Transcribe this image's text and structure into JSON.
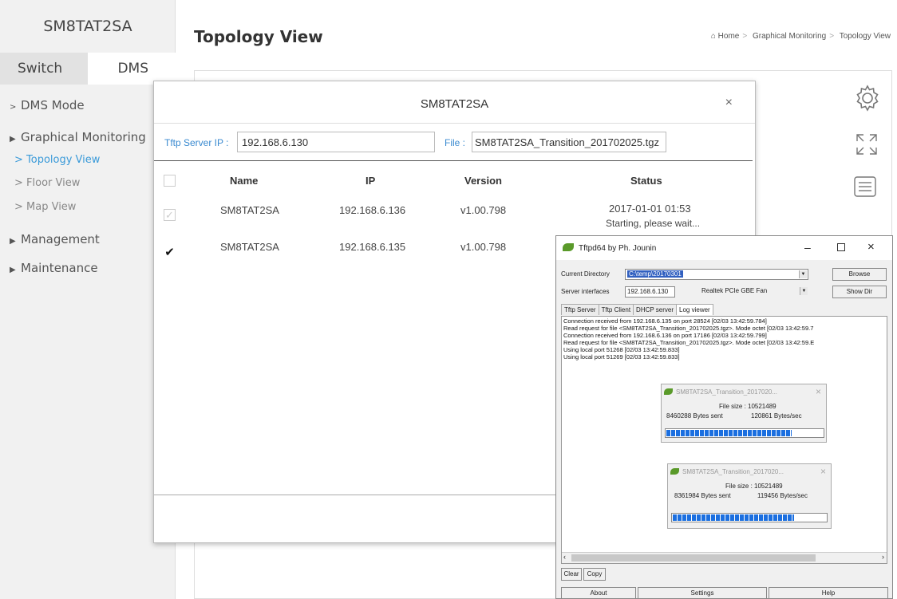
{
  "sidebar": {
    "title": "SM8TAT2SA",
    "tabs": [
      "Switch",
      "DMS"
    ],
    "items": [
      {
        "label": "DMS Mode",
        "arrow": ">"
      },
      {
        "label": "Graphical Monitoring",
        "arrow": "▶"
      },
      {
        "label": "Management",
        "arrow": "▶"
      },
      {
        "label": "Maintenance",
        "arrow": "▶"
      }
    ],
    "subitems": [
      "> Topology View",
      "> Floor View",
      "> Map View"
    ]
  },
  "header": {
    "title": "Topology View",
    "breadcrumb": [
      "Home",
      "Graphical Monitoring",
      "Topology View"
    ]
  },
  "modal": {
    "title": "SM8TAT2SA",
    "close": "×",
    "tftp_label": "Tftp Server IP :",
    "tftp_value": "192.168.6.130",
    "file_label": "File :",
    "file_value": "SM8TAT2SA_Transition_201702025.tgz",
    "columns": [
      "Name",
      "IP",
      "Version",
      "Status"
    ],
    "rows": [
      {
        "name": "SM8TAT2SA",
        "ip": "192.168.6.136",
        "version": "v1.00.798",
        "status": "2017-01-01 01:53",
        "status2": "Starting, please wait...",
        "checked": "✓"
      },
      {
        "name": "SM8TAT2SA",
        "ip": "192.168.6.135",
        "version": "v1.00.798",
        "status": "",
        "status2": "",
        "checked": "✔"
      }
    ]
  },
  "tftpd": {
    "title": "Tftpd64 by Ph. Jounin",
    "dir_label": "Current Directory",
    "dir_value": "C:\\temp\\20170301",
    "iface_label": "Server interfaces",
    "iface_value": "192.168.6.130",
    "iface_desc": "Realtek PCIe GBE Fan",
    "browse": "Browse",
    "show_dir": "Show Dir",
    "tabs": [
      "Tftp Server",
      "Tftp Client",
      "DHCP server",
      "Log viewer"
    ],
    "log": [
      "Connection received from 192.168.6.135 on port 28524 [02/03 13:42:59.784]",
      "Read request for file <SM8TAT2SA_Transition_201702025.tgz>. Mode octet [02/03 13:42:59.7",
      "Connection received from 192.168.6.136 on port 17186 [02/03 13:42:59.799]",
      "Read request for file <SM8TAT2SA_Transition_201702025.tgz>. Mode octet [02/03 13:42:59.E",
      "Using local port 51268 [02/03 13:42:59.833]",
      "Using local port 51269 [02/03 13:42:59.833]"
    ],
    "progress": [
      {
        "title": "SM8TAT2SA_Transition_2017020...",
        "size": "File size : 10521489",
        "sent": "8460288 Bytes sent",
        "rate": "120861 Bytes/sec",
        "fraction": 0.8
      },
      {
        "title": "SM8TAT2SA_Transition_2017020...",
        "size": "File size : 10521489",
        "sent": "8361984 Bytes sent",
        "rate": "119456 Bytes/sec",
        "fraction": 0.79
      }
    ],
    "clear": "Clear",
    "copy": "Copy",
    "about": "About",
    "settings": "Settings",
    "help": "Help"
  }
}
